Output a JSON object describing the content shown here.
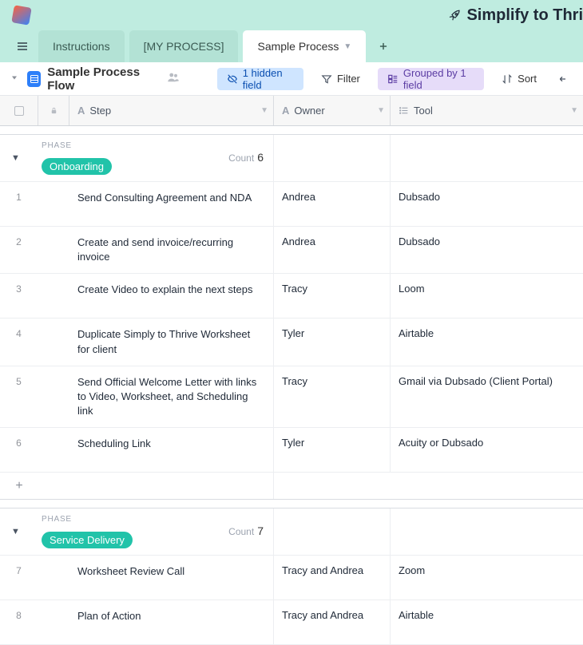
{
  "header": {
    "title": "Simplify to Thri"
  },
  "tabs": [
    {
      "label": "Instructions"
    },
    {
      "label": "[MY PROCESS]"
    },
    {
      "label": "Sample Process"
    }
  ],
  "view": {
    "name": "Sample Process Flow"
  },
  "toolbar": {
    "hidden": "1 hidden field",
    "filter": "Filter",
    "grouped": "Grouped by 1 field",
    "sort": "Sort"
  },
  "columns": {
    "step": "Step",
    "owner": "Owner",
    "tool": "Tool"
  },
  "groups": [
    {
      "label": "PHASE",
      "chip": "Onboarding",
      "count_label": "Count",
      "count": "6",
      "rows": [
        {
          "n": "1",
          "step": "Send Consulting Agreement and NDA",
          "owner": "Andrea",
          "tool": "Dubsado"
        },
        {
          "n": "2",
          "step": "Create and send invoice/recurring invoice",
          "owner": "Andrea",
          "tool": "Dubsado"
        },
        {
          "n": "3",
          "step": "Create Video to explain the next steps",
          "owner": "Tracy",
          "tool": "Loom"
        },
        {
          "n": "4",
          "step": "Duplicate Simply to Thrive Worksheet for client",
          "owner": "Tyler",
          "tool": "Airtable"
        },
        {
          "n": "5",
          "step": "Send Official Welcome Letter with links to Video, Worksheet, and Scheduling link",
          "owner": "Tracy",
          "tool": "Gmail via Dubsado (Client Portal)"
        },
        {
          "n": "6",
          "step": "Scheduling Link",
          "owner": "Tyler",
          "tool": "Acuity or Dubsado"
        }
      ]
    },
    {
      "label": "PHASE",
      "chip": "Service Delivery",
      "count_label": "Count",
      "count": "7",
      "rows": [
        {
          "n": "7",
          "step": "Worksheet Review Call",
          "owner": "Tracy and Andrea",
          "tool": "Zoom"
        },
        {
          "n": "8",
          "step": "Plan of Action",
          "owner": "Tracy and Andrea",
          "tool": "Airtable"
        }
      ]
    }
  ]
}
